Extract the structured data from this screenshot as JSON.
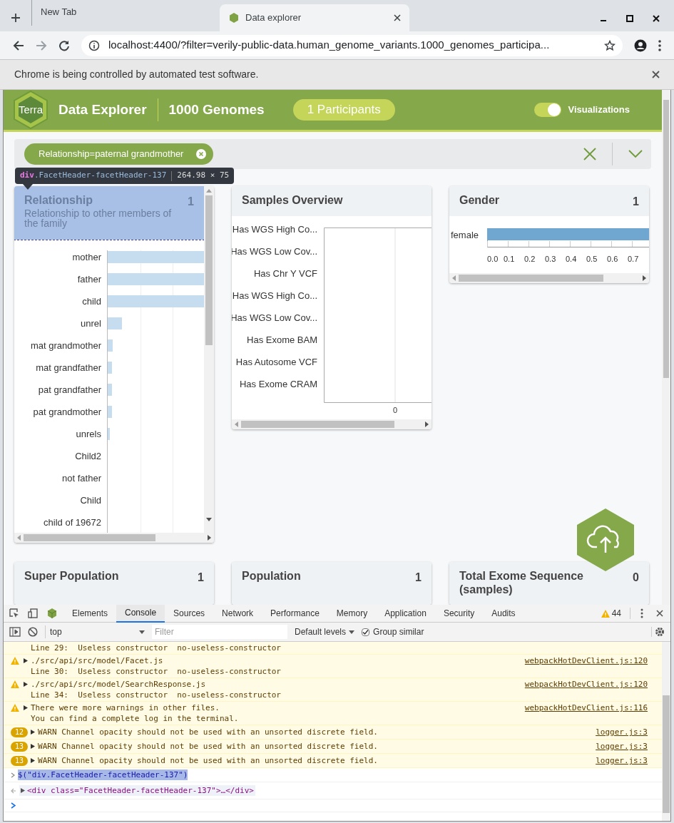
{
  "browser": {
    "tabs": [
      {
        "title": "New Tab",
        "selected": false
      },
      {
        "title": "Data explorer",
        "selected": true
      }
    ],
    "address": "localhost:4400/?filter=verily-public-data.human_genome_variants.1000_genomes_participa...",
    "infobar": "Chrome is being controlled by automated test software."
  },
  "app": {
    "logo": "Terra",
    "title": "Data Explorer",
    "dataset": "1000 Genomes",
    "participants": "1 Participants",
    "visualizations": {
      "label": "Visualizations",
      "on": true
    }
  },
  "filters": [
    {
      "label": "Relationship=paternal grandmother"
    }
  ],
  "inspect_tooltip": {
    "tag": "div",
    "class": ".FacetHeader-facetHeader-137",
    "size": "264.98 × 75"
  },
  "facets": [
    {
      "kind": "bars",
      "name": "Relationship",
      "count": "1",
      "description": "Relationship to other members of the family",
      "highlighted": true,
      "labels": [
        "mother",
        "father",
        "child",
        "unrel",
        "mat grandmother",
        "mat grandfather",
        "pat grandfather",
        "pat grandmother",
        "unrels",
        "Child2",
        "not father",
        "Child",
        "child of 19672"
      ]
    },
    {
      "kind": "chart",
      "name": "Samples Overview",
      "highlighted": false,
      "labels": [
        "Has WGS High Co...",
        "Has WGS Low Cov...",
        "Has Chr Y VCF",
        "Has WGS High Co...",
        "Has WGS Low Cov...",
        "Has Exome BAM",
        "Has Autosome VCF",
        "Has Exome CRAM"
      ],
      "tick_labels": [
        "0"
      ]
    },
    {
      "kind": "chart",
      "name": "Gender",
      "count": "1",
      "highlighted": false,
      "labels": [
        "female"
      ],
      "tick_labels": [
        "0.0",
        "0.1",
        "0.2",
        "0.3",
        "0.4",
        "0.5",
        "0.6",
        "0.7"
      ]
    },
    {
      "kind": "empty",
      "name": "Super Population",
      "count": "1",
      "highlighted": false
    },
    {
      "kind": "empty",
      "name": "Population",
      "count": "1",
      "highlighted": false
    },
    {
      "kind": "empty",
      "name": "Total Exome Sequence (samples)",
      "count": "0",
      "highlighted": false
    }
  ],
  "devtools": {
    "tabs": [
      {
        "label": "Elements",
        "selected": false
      },
      {
        "label": "Console",
        "selected": true
      },
      {
        "label": "Sources",
        "selected": false
      },
      {
        "label": "Network",
        "selected": false
      },
      {
        "label": "Performance",
        "selected": false
      },
      {
        "label": "Memory",
        "selected": false
      },
      {
        "label": "Application",
        "selected": false
      },
      {
        "label": "Security",
        "selected": false
      },
      {
        "label": "Audits",
        "selected": false
      }
    ],
    "warnings": "44",
    "context": "top",
    "filter_placeholder": "Filter",
    "levels": "Default levels",
    "group_similar": {
      "label": "Group similar",
      "checked": true
    },
    "messages": [
      {
        "kind": "warning",
        "icon": false,
        "lines": [
          "Line 29:  Useless constructor  no-useless-constructor"
        ]
      },
      {
        "kind": "warning",
        "icon": true,
        "lines": [
          "./src/api/src/model/Facet.js",
          "Line 30:  Useless constructor  no-useless-constructor"
        ],
        "source": "webpackHotDevClient.js:120"
      },
      {
        "kind": "warning",
        "icon": true,
        "lines": [
          "./src/api/src/model/SearchResponse.js",
          "Line 34:  Useless constructor  no-useless-constructor"
        ],
        "source": "webpackHotDevClient.js:120"
      },
      {
        "kind": "warning",
        "icon": true,
        "lines": [
          "There were more warnings in other files.",
          "You can find a complete log in the terminal."
        ],
        "source": "webpackHotDevClient.js:116"
      },
      {
        "kind": "repeat",
        "count": "12",
        "lines": [
          "WARN Channel opacity should not be used with an unsorted discrete field."
        ],
        "source": "logger.js:3"
      },
      {
        "kind": "repeat",
        "count": "13",
        "lines": [
          "WARN Channel opacity should not be used with an unsorted discrete field."
        ],
        "source": "logger.js:3"
      },
      {
        "kind": "repeat",
        "count": "13",
        "lines": [
          "WARN Channel opacity should not be used with an unsorted discrete field."
        ],
        "source": "logger.js:3"
      },
      {
        "kind": "input",
        "lines": [
          "$(\"div.FacetHeader-facetHeader-137\")"
        ]
      },
      {
        "kind": "output",
        "lines": [
          "<div class=\"FacetHeader-facetHeader-137\">…</div>"
        ]
      },
      {
        "kind": "prompt"
      }
    ]
  }
}
